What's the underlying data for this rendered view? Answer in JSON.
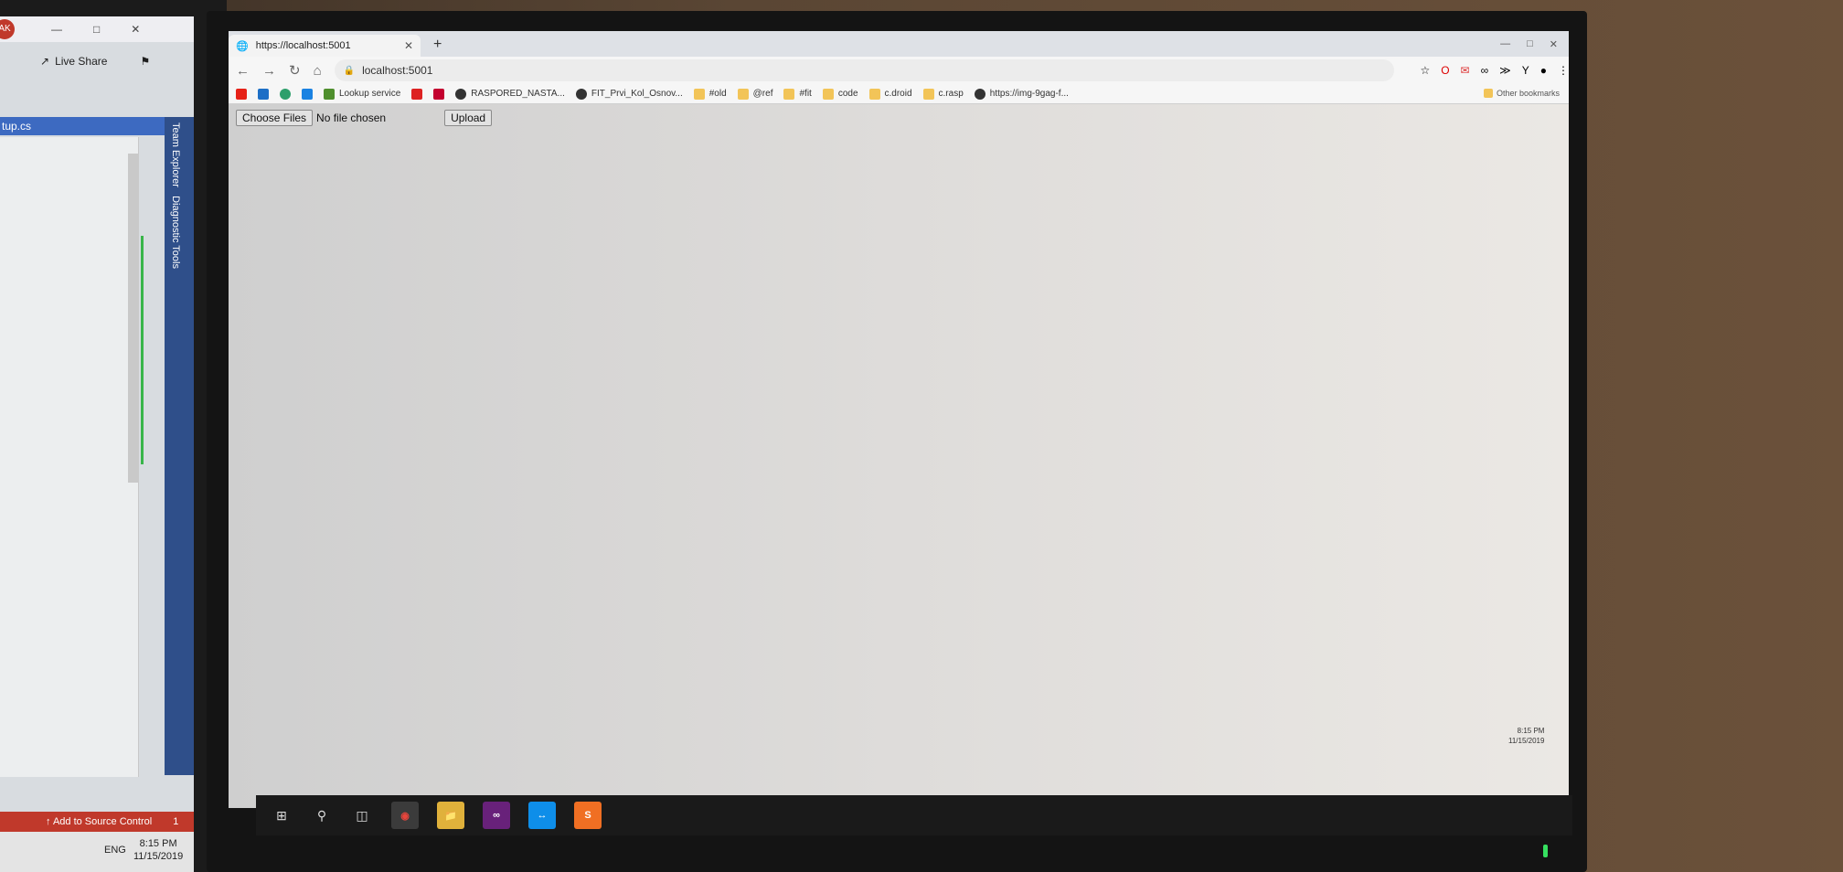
{
  "vs": {
    "avatar": "AK",
    "live_share": "Live Share",
    "tab_label": "tup.cs",
    "side_labels": [
      "Team Explorer",
      "Diagnostic Tools"
    ],
    "status_text": "Add to Source Control",
    "status_badge": "1",
    "tray_lang": "ENG",
    "tray_time": "8:15 PM",
    "tray_date": "11/15/2019"
  },
  "browser": {
    "tab_title": "https://localhost:5001",
    "new_tab": "+",
    "url": "localhost:5001",
    "bookmarks": [
      {
        "label": "",
        "icon": "youtube-icon",
        "color": "#e62117"
      },
      {
        "label": "",
        "icon": "trello-icon",
        "color": "#1d6fc6"
      },
      {
        "label": "",
        "icon": "globe-icon",
        "color": "#2c9f6b"
      },
      {
        "label": "",
        "icon": "dropbox-icon",
        "color": "#1a82e2"
      },
      {
        "label": "Lookup service",
        "icon": "service-icon",
        "color": "#4f8f2d"
      },
      {
        "label": "",
        "icon": "x-icon",
        "color": "#d22"
      },
      {
        "label": "",
        "icon": "angular-icon",
        "color": "#c3002f"
      },
      {
        "label": "RASPORED_NASTA...",
        "icon": "globe-icon",
        "color": "#333"
      },
      {
        "label": "FIT_Prvi_Kol_Osnov...",
        "icon": "globe-icon",
        "color": "#333"
      },
      {
        "label": "#old",
        "icon": "folder-icon",
        "color": "#f2c458"
      },
      {
        "label": "@ref",
        "icon": "folder-icon",
        "color": "#f2c458"
      },
      {
        "label": "#fit",
        "icon": "folder-icon",
        "color": "#f2c458"
      },
      {
        "label": "code",
        "icon": "folder-icon",
        "color": "#f2c458"
      },
      {
        "label": "c.droid",
        "icon": "folder-icon",
        "color": "#f2c458"
      },
      {
        "label": "c.rasp",
        "icon": "folder-icon",
        "color": "#f2c458"
      },
      {
        "label": "https://img-9gag-f...",
        "icon": "globe-icon",
        "color": "#333"
      }
    ],
    "other_bookmarks": "Other bookmarks"
  },
  "page": {
    "choose_files": "Choose Files",
    "no_file": "No file chosen",
    "upload": "Upload"
  },
  "system": {
    "clock_time": "8:15 PM",
    "clock_date": "11/15/2019"
  }
}
